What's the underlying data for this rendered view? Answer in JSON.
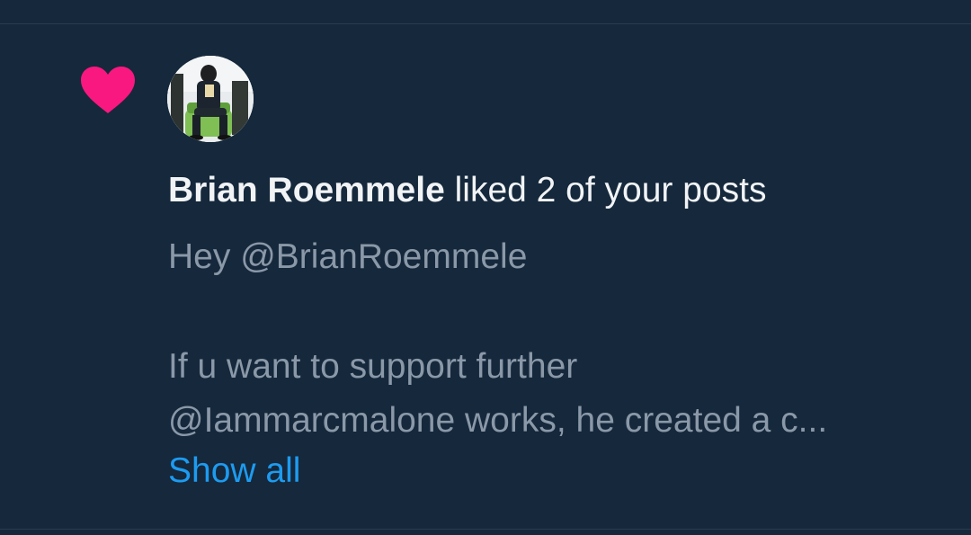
{
  "notification": {
    "type_icon": "heart-icon",
    "type_icon_color": "#f91880",
    "user_name": "Brian Roemmele",
    "action_text": " liked 2 of your posts",
    "post_preview_line1": "Hey @BrianRoemmele",
    "post_preview_line2": "If u want to support further",
    "post_preview_line3": "@Iammarcmalone works, he created a c...",
    "show_all_label": "Show all",
    "link_color": "#1d9bf0"
  },
  "colors": {
    "background": "#15283c",
    "text_primary": "#f1f3f5",
    "text_secondary": "#8a98a8"
  }
}
